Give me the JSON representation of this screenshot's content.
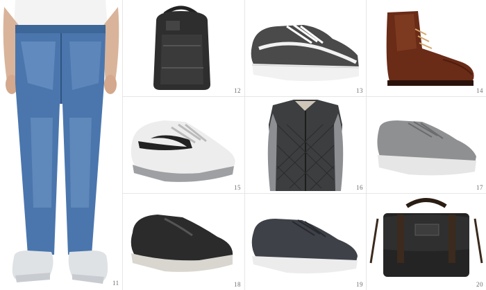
{
  "items": [
    {
      "number": "11",
      "product": "jeans-icon"
    },
    {
      "number": "12",
      "product": "backpack-icon"
    },
    {
      "number": "13",
      "product": "skate-sneaker-icon"
    },
    {
      "number": "14",
      "product": "leather-boot-icon"
    },
    {
      "number": "15",
      "product": "running-shoe-icon"
    },
    {
      "number": "16",
      "product": "quilted-vest-icon"
    },
    {
      "number": "17",
      "product": "grey-sneaker-icon"
    },
    {
      "number": "18",
      "product": "black-sneaker-icon"
    },
    {
      "number": "19",
      "product": "suede-sneaker-icon"
    },
    {
      "number": "20",
      "product": "messenger-bag-icon"
    }
  ],
  "colors": {
    "denim": "#3f6aa0",
    "denim_light": "#6b93c4",
    "leather_brown": "#6a2b17",
    "charcoal": "#2b2b2b",
    "grey": "#8f9092",
    "grid_line": "#e6e6e6",
    "label": "#6b6b6b"
  }
}
